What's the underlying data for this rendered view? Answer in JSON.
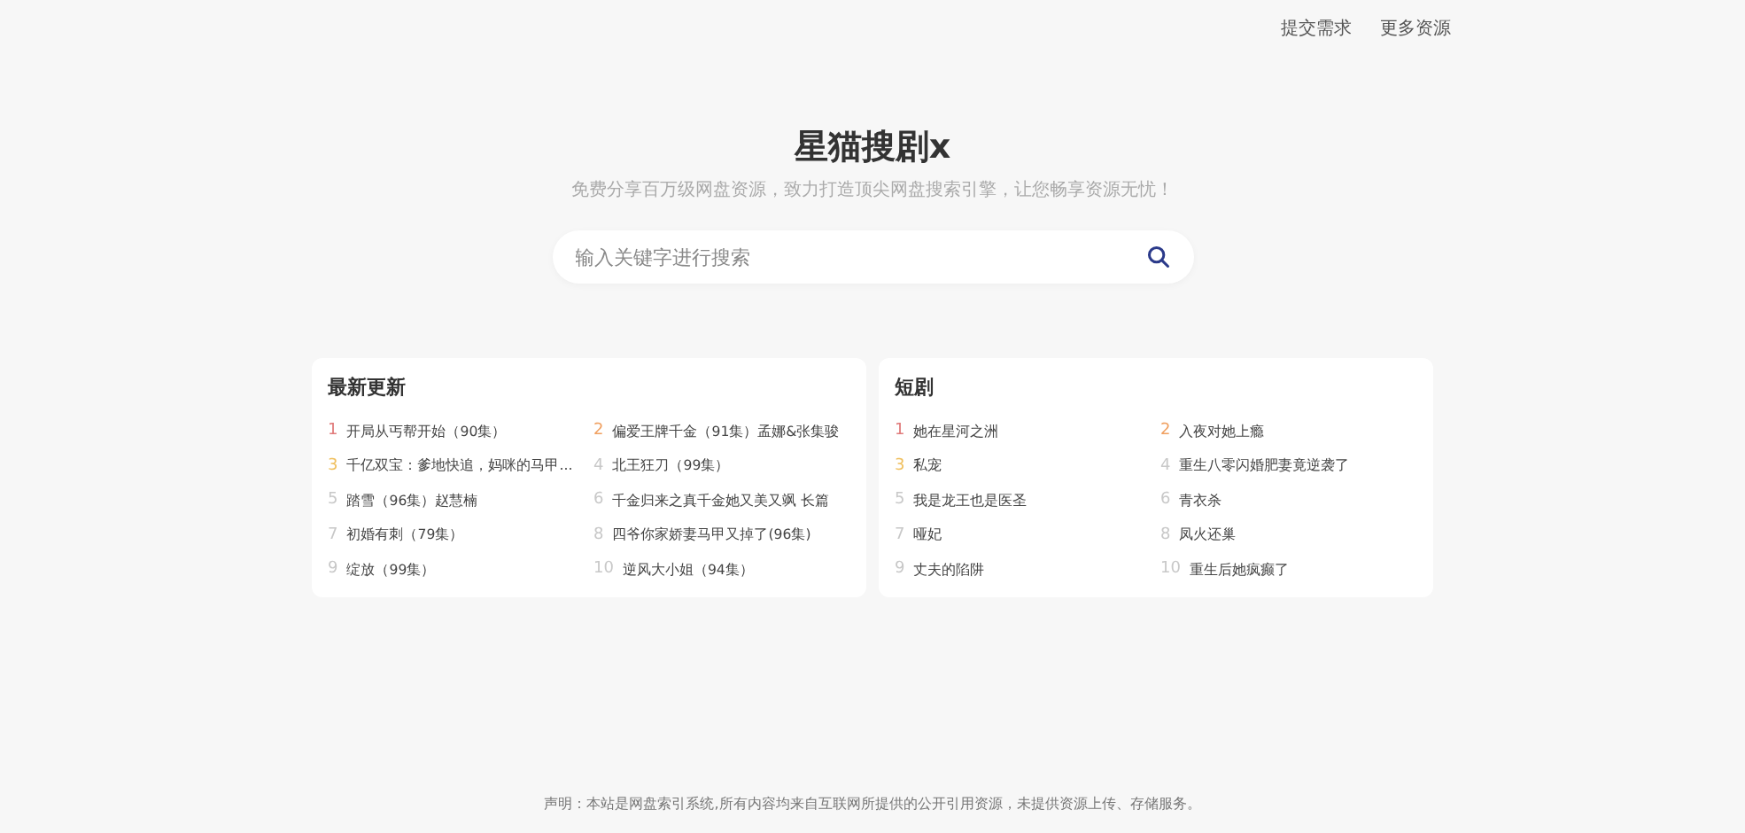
{
  "top_links": [
    "提交需求",
    "更多资源"
  ],
  "site": {
    "title": "星猫搜剧x",
    "subtitle": "免费分享百万级网盘资源，致力打造顶尖网盘搜索引擎，让您畅享资源无忧！"
  },
  "search": {
    "placeholder": "输入关键字进行搜索"
  },
  "panels": [
    {
      "title": "最新更新",
      "items": [
        {
          "rank": "1",
          "title": "开局从丐帮开始（90集）",
          "color": "#e07a7a"
        },
        {
          "rank": "2",
          "title": "偏爱王牌千金（91集）孟娜&张集骏",
          "color": "#f0a060"
        },
        {
          "rank": "3",
          "title": "千亿双宝：爹地快追，妈咪的马甲...",
          "color": "#f0c060"
        },
        {
          "rank": "4",
          "title": "北王狂刀（99集）",
          "color": "#c8c8c8"
        },
        {
          "rank": "5",
          "title": "踏雪（96集）赵慧楠",
          "color": "#c8c8c8"
        },
        {
          "rank": "6",
          "title": "千金归来之真千金她又美又飒 长篇",
          "color": "#c8c8c8"
        },
        {
          "rank": "7",
          "title": "初婚有刺（79集）",
          "color": "#c8c8c8"
        },
        {
          "rank": "8",
          "title": "四爷你家娇妻马甲又掉了(96集)",
          "color": "#c8c8c8"
        },
        {
          "rank": "9",
          "title": "绽放（99集）",
          "color": "#c8c8c8"
        },
        {
          "rank": "10",
          "title": "逆风大小姐（94集）",
          "color": "#c8c8c8"
        }
      ]
    },
    {
      "title": "短剧",
      "items": [
        {
          "rank": "1",
          "title": "她在星河之洲",
          "color": "#e07a7a"
        },
        {
          "rank": "2",
          "title": "入夜对她上瘾",
          "color": "#f0a060"
        },
        {
          "rank": "3",
          "title": "私宠",
          "color": "#f0c060"
        },
        {
          "rank": "4",
          "title": "重生八零闪婚肥妻竟逆袭了",
          "color": "#c8c8c8"
        },
        {
          "rank": "5",
          "title": "我是龙王也是医圣",
          "color": "#c8c8c8"
        },
        {
          "rank": "6",
          "title": "青衣杀",
          "color": "#c8c8c8"
        },
        {
          "rank": "7",
          "title": "哑妃",
          "color": "#c8c8c8"
        },
        {
          "rank": "8",
          "title": "凤火还巢",
          "color": "#c8c8c8"
        },
        {
          "rank": "9",
          "title": "丈夫的陷阱",
          "color": "#c8c8c8"
        },
        {
          "rank": "10",
          "title": "重生后她疯癫了",
          "color": "#c8c8c8"
        }
      ]
    }
  ],
  "footer": {
    "disclaimer": "声明：本站是网盘索引系统,所有内容均来自互联网所提供的公开引用资源，未提供资源上传、存储服务。"
  }
}
